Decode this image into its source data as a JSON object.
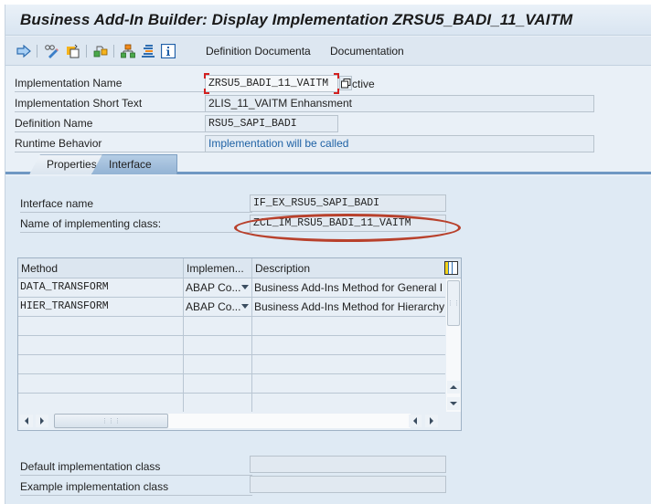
{
  "window": {
    "title": "Business Add-In Builder: Display Implementation ZRSU5_BADI_11_VAITM"
  },
  "toolbar": {
    "icons": [
      "back-arrow-icon",
      "display-change-icon",
      "activate-icon",
      "object-list-icon",
      "hierarchy-icon",
      "stack-icon",
      "info-icon"
    ],
    "definition_doc_label": "Definition Documenta",
    "documentation_label": "Documentation"
  },
  "header_fields": {
    "implementation_name": {
      "label": "Implementation Name",
      "value": "ZRSU5_BADI_11_VAITM",
      "status": "Active",
      "status_visible": "ctive"
    },
    "short_text": {
      "label": "Implementation Short Text",
      "value": "2LIS_11_VAITM Enhansment"
    },
    "definition_name": {
      "label": "Definition Name",
      "value": "RSU5_SAPI_BADI"
    },
    "runtime_behavior": {
      "label": "Runtime Behavior",
      "value": "Implementation will be called"
    }
  },
  "tabs": [
    {
      "label": "Properties",
      "active": false
    },
    {
      "label": "Interface",
      "active": true
    }
  ],
  "interface": {
    "interface_name": {
      "label": "Interface name",
      "value": "IF_EX_RSU5_SAPI_BADI"
    },
    "implementing_class": {
      "label": "Name of implementing class:",
      "value": "ZCL_IM_RSU5_BADI_11_VAITM"
    }
  },
  "methods_table": {
    "columns": [
      "Method",
      "Implemen...",
      "Description"
    ],
    "rows": [
      {
        "method": "DATA_TRANSFORM",
        "implementation": "ABAP Co...",
        "description": "Business Add-Ins Method for General I"
      },
      {
        "method": "HIER_TRANSFORM",
        "implementation": "ABAP Co...",
        "description": "Business Add-Ins Method for Hierarchy"
      }
    ],
    "empty_rows": 5
  },
  "bottom_fields": {
    "default_class": {
      "label": "Default implementation class",
      "value": ""
    },
    "example_class": {
      "label": "Example implementation class",
      "value": ""
    }
  },
  "colors": {
    "highlight_circle": "#b8412c",
    "link_blue": "#1f62a5",
    "focus_red": "#d32020"
  }
}
